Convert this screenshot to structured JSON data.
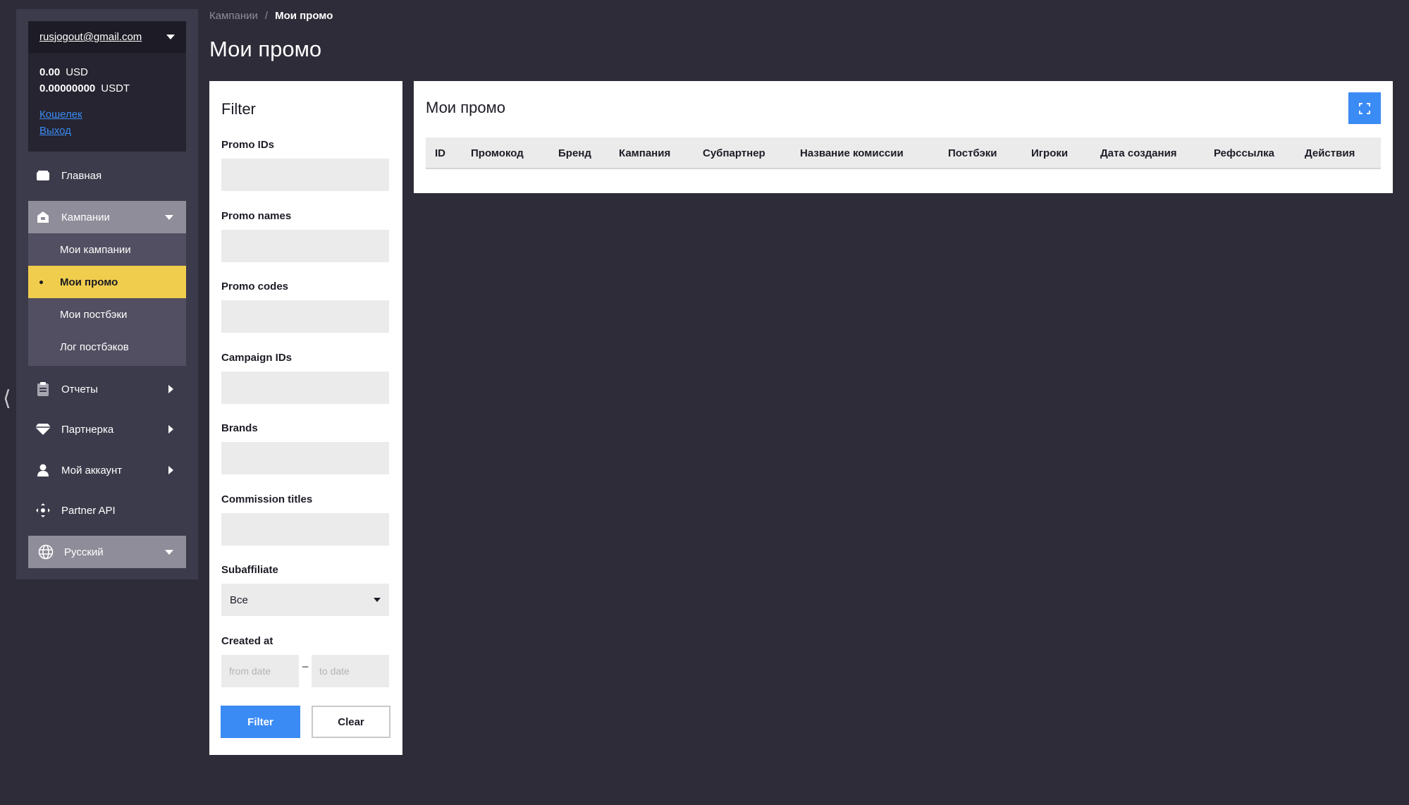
{
  "account": {
    "email": "rusjogout@gmail.com",
    "balances": [
      {
        "amount": "0.00",
        "currency": "USD"
      },
      {
        "amount": "0.00000000",
        "currency": "USDT"
      }
    ],
    "wallet_link": "Кошелек",
    "logout_link": "Выход"
  },
  "sidebar": {
    "home": "Главная",
    "campaigns": "Кампании",
    "campaign_items": [
      "Мои кампании",
      "Мои промо",
      "Мои постбэки",
      "Лог постбэков"
    ],
    "reports": "Отчеты",
    "partner": "Партнерка",
    "my_account": "Мой аккаунт",
    "partner_api": "Partner API",
    "language": "Русский"
  },
  "breadcrumb": {
    "parent": "Кампании",
    "separator": "/",
    "current": "Мои промо"
  },
  "page_title": "Мои промо",
  "filter": {
    "title": "Filter",
    "promo_ids": "Promo IDs",
    "promo_names": "Promo names",
    "promo_codes": "Promo codes",
    "campaign_ids": "Campaign IDs",
    "brands": "Brands",
    "commission_titles": "Commission titles",
    "subaffiliate": "Subaffiliate",
    "subaffiliate_value": "Все",
    "created_at": "Created at",
    "from_date_placeholder": "from date",
    "date_dash": "–",
    "to_date_placeholder": "to date",
    "filter_button": "Filter",
    "clear_button": "Clear"
  },
  "table": {
    "title": "Мои промо",
    "columns": [
      "ID",
      "Промокод",
      "Бренд",
      "Кампания",
      "Субпартнер",
      "Название комиссии",
      "Постбэки",
      "Игроки",
      "Дата создания",
      "Рефссылка",
      "Действия"
    ]
  }
}
